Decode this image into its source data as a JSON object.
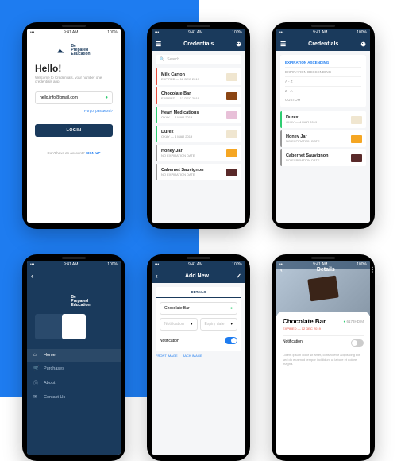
{
  "status": {
    "time": "9:41 AM",
    "carrier": "•••",
    "batt": "100%"
  },
  "brand": {
    "line1": "Be",
    "line2": "Prepared",
    "line3": "Education"
  },
  "login": {
    "greet": "Hello!",
    "sub": "Welcome to Credentials, your number one credentials app.",
    "email": "hello.info@gmail.com",
    "btn": "LOGIN",
    "forgot": "Forgot password?",
    "noacct": "Don't have an account? ",
    "signup": "SIGN UP"
  },
  "cred": {
    "title": "Credentials",
    "search": "Search...",
    "items": [
      {
        "n": "Milk Carton",
        "s": "EXPIRED — 12 DEC 2019",
        "st": "exp",
        "th": ""
      },
      {
        "n": "Chocolate Bar",
        "s": "EXPIRED — 12 DEC 2019",
        "st": "exp",
        "th": "b"
      },
      {
        "n": "Heart Medications",
        "s": "OKAY — 4 MAR 2019",
        "st": "ok",
        "th": "p"
      },
      {
        "n": "Durex",
        "s": "OKAY — 4 MAR 2019",
        "st": "ok",
        "th": ""
      },
      {
        "n": "Honey Jar",
        "s": "NO EXPIRATION DATE",
        "st": "rec",
        "th": "o"
      },
      {
        "n": "Cabernet Sauvignon",
        "s": "NO EXPIRATION DATE",
        "st": "rec",
        "th": "d"
      }
    ]
  },
  "sort": {
    "opts": [
      "EXPIRATION ASCENDING",
      "EXPIRATION DESCENDING",
      "A - Z",
      "Z - A"
    ],
    "custom": "CUSTOM",
    "items": [
      {
        "n": "Durex",
        "s": "OKAY — 4 MAR 2019",
        "st": "ok",
        "th": ""
      },
      {
        "n": "Honey Jar",
        "s": "NO EXPIRATION DATE",
        "st": "rec",
        "th": "o"
      },
      {
        "n": "Cabernet Sauvignon",
        "s": "NO EXPIRATION DATE",
        "st": "rec",
        "th": "d"
      }
    ]
  },
  "nav": {
    "items": [
      {
        "ic": "⌂",
        "l": "Home",
        "a": true
      },
      {
        "ic": "🛒",
        "l": "Purchases"
      },
      {
        "ic": "ⓘ",
        "l": "About"
      },
      {
        "ic": "✉",
        "l": "Contact Us"
      }
    ]
  },
  "add": {
    "title": "Add New",
    "tabs": [
      "DETAILS"
    ],
    "name": "Chocolate Bar",
    "ph_notif": "Notification",
    "ph_date": "Expiry date",
    "notif": "Notification",
    "links": [
      "FRONT IMAGE",
      "BACK IMAGE"
    ]
  },
  "det": {
    "title": "Details",
    "name": "Chocolate Bar",
    "id": "6173HDIM",
    "status": "EXPIRED — 12 DEC 2019",
    "notif": "Notification",
    "lorem": "Lorem ipsum dolor sit amet, consectetur adipisicing elit, sed do eiusmod tempor incididunt ut labore et dolore magna."
  }
}
